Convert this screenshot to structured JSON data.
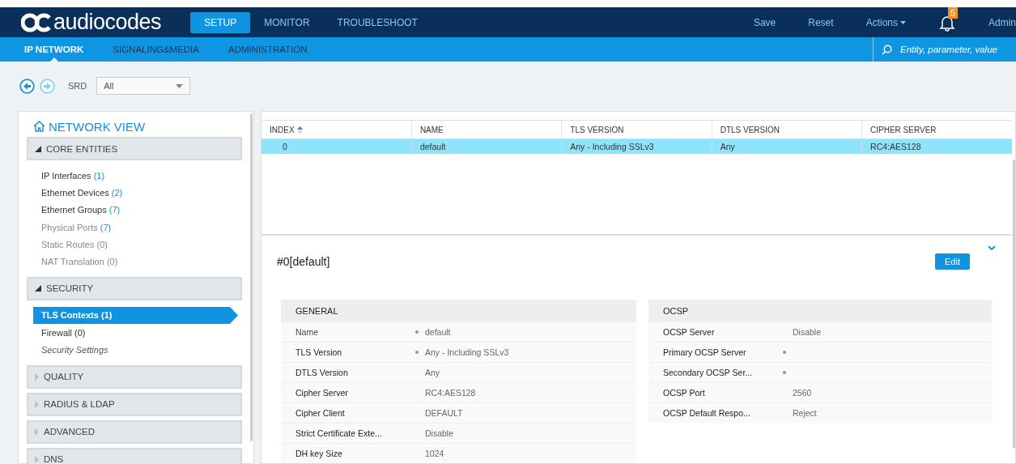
{
  "header": {
    "logo": "audiocodes",
    "menu": [
      {
        "label": "SETUP",
        "selected": true
      },
      {
        "label": "MONITOR",
        "selected": false
      },
      {
        "label": "TROUBLESHOOT",
        "selected": false
      }
    ],
    "actions": [
      "Save",
      "Reset",
      "Actions"
    ],
    "notifications": "5",
    "user": "Admin"
  },
  "subnav": {
    "tabs": [
      {
        "label": "IP NETWORK",
        "selected": true
      },
      {
        "label": "SIGNALING&MEDIA",
        "selected": false
      },
      {
        "label": "ADMINISTRATION",
        "selected": false
      }
    ],
    "search": {
      "placeholder": "Entity, parameter, value"
    }
  },
  "toolbar": {
    "back_disabled": false,
    "forward_disabled": true,
    "srd_label": "SRD",
    "srd_value": "All"
  },
  "sidebar": {
    "title": "NETWORK VIEW",
    "sections": [
      {
        "label": "CORE ENTITIES",
        "expanded": true,
        "items": [
          {
            "kind": "link",
            "label": "IP Interfaces",
            "count": "(1)",
            "active": true,
            "count_highlight": true,
            "selected": false
          },
          {
            "kind": "link",
            "label": "Ethernet Devices",
            "count": "(2)",
            "active": true,
            "count_highlight": true,
            "selected": false
          },
          {
            "kind": "link",
            "label": "Ethernet Groups",
            "count": "(7)",
            "active": true,
            "count_highlight": true,
            "selected": false
          },
          {
            "kind": "link",
            "label": "Physical Ports",
            "count": "(7)",
            "active": false,
            "count_highlight": true,
            "selected": false
          },
          {
            "kind": "link",
            "label": "Static Routes",
            "count": "(0)",
            "active": false,
            "count_highlight": false,
            "selected": false
          },
          {
            "kind": "link",
            "label": "NAT Translation",
            "count": "(0)",
            "active": false,
            "count_highlight": false,
            "selected": false
          }
        ]
      },
      {
        "label": "SECURITY",
        "expanded": true,
        "items": [
          {
            "kind": "link",
            "label": "TLS Contexts",
            "count": "(1)",
            "active": true,
            "count_highlight": true,
            "selected": true
          },
          {
            "kind": "link",
            "label": "Firewall",
            "count": "(0)",
            "active": true,
            "count_highlight": false,
            "selected": false
          },
          {
            "kind": "setting",
            "label": "Security Settings",
            "selected": false
          }
        ]
      },
      {
        "label": "QUALITY",
        "expanded": false
      },
      {
        "label": "RADIUS & LDAP",
        "expanded": false
      },
      {
        "label": "ADVANCED",
        "expanded": false
      },
      {
        "label": "DNS",
        "expanded": false
      }
    ]
  },
  "table": {
    "columns": [
      "INDEX",
      "NAME",
      "TLS VERSION",
      "DTLS VERSION",
      "CIPHER SERVER"
    ],
    "rows": [
      {
        "cells": [
          "0",
          "default",
          "Any - Including SSLv3",
          "Any",
          "RC4:AES128"
        ],
        "selected": true
      }
    ]
  },
  "detail": {
    "title": "#0[default]",
    "edit": "Edit",
    "groups": [
      {
        "title": "GENERAL",
        "rows": [
          {
            "label": "Name",
            "value": "default",
            "changed": true,
            "strong": false
          },
          {
            "label": "TLS Version",
            "value": "Any - Including SSLv3",
            "changed": true,
            "strong": true
          },
          {
            "label": "DTLS Version",
            "value": "Any",
            "changed": false,
            "strong": true
          },
          {
            "label": "Cipher Server",
            "value": "RC4:AES128",
            "changed": false,
            "strong": true
          },
          {
            "label": "Cipher Client",
            "value": "DEFAULT",
            "changed": false,
            "strong": true
          },
          {
            "label": "Strict Certificate Exte...",
            "value": "Disable",
            "changed": false,
            "strong": true
          },
          {
            "label": "DH key Size",
            "value": "1024",
            "changed": false,
            "strong": true
          }
        ]
      },
      {
        "title": "OCSP",
        "rows": [
          {
            "label": "OCSP Server",
            "value": "Disable",
            "changed": false,
            "strong": true
          },
          {
            "label": "Primary OCSP Server",
            "changed": true,
            "strong": true
          },
          {
            "label": "Secondary OCSP Ser...",
            "changed": true,
            "strong": true
          },
          {
            "label": "OCSP Port",
            "value": "2560",
            "changed": false,
            "strong": true
          },
          {
            "label": "OCSP Default Respo...",
            "value": "Reject",
            "changed": false,
            "strong": true
          }
        ]
      }
    ]
  }
}
